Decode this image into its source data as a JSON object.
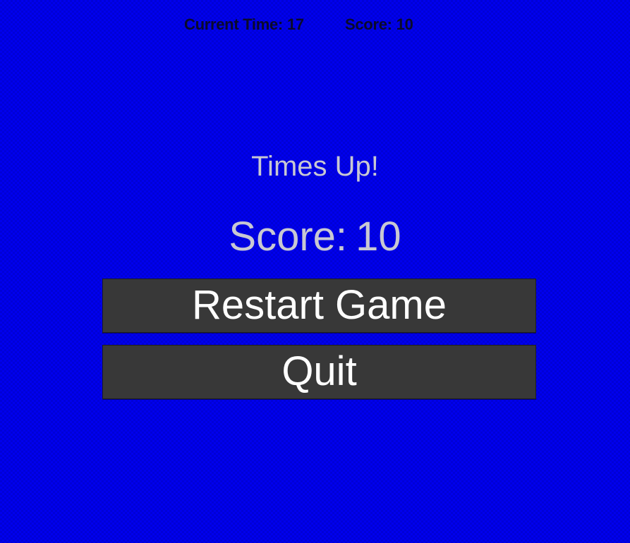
{
  "hud": {
    "time_label": "Current Time:",
    "time_value": "17",
    "score_label": "Score:",
    "score_value": "10"
  },
  "game_over": {
    "message": "Times Up!",
    "score_label": "Score:",
    "score_value": "10"
  },
  "buttons": {
    "restart_label": "Restart Game",
    "quit_label": "Quit"
  },
  "colors": {
    "background": "#0000ee",
    "button_bg": "#383838",
    "button_text": "#ffffff",
    "message_text": "#c8c8d2",
    "hud_text": "#0a0a2a"
  }
}
